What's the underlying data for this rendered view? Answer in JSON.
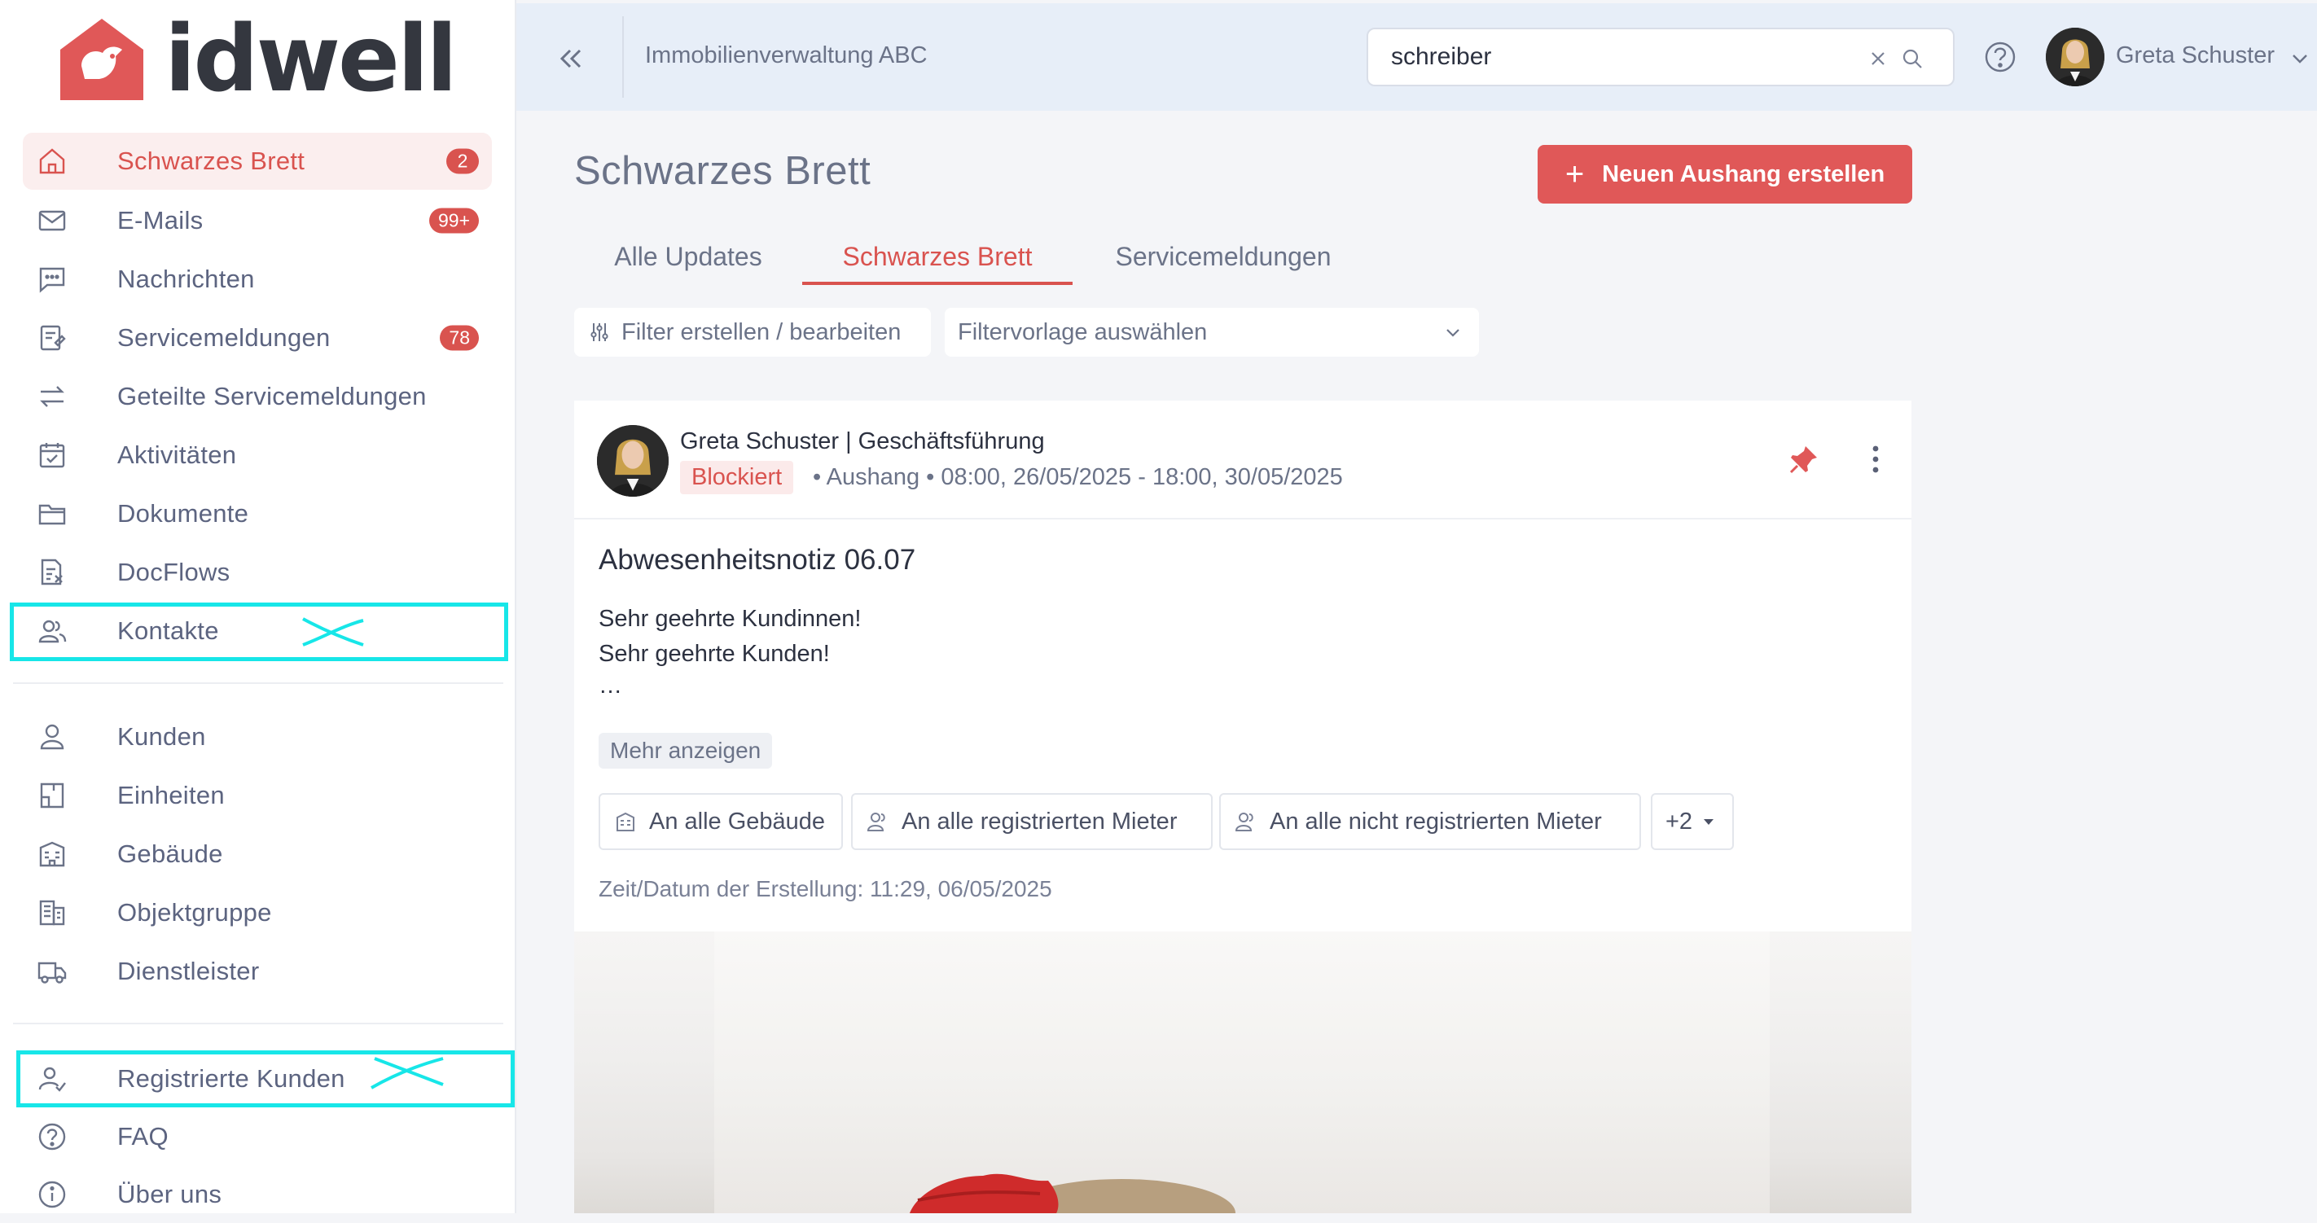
{
  "brand": {
    "name": "idwell",
    "color": "#e05858"
  },
  "sidebar": {
    "items": [
      {
        "label": "Schwarzes Brett",
        "icon": "home-icon",
        "badge": "2",
        "active": true
      },
      {
        "label": "E-Mails",
        "icon": "mail-icon",
        "badge": "99+"
      },
      {
        "label": "Nachrichten",
        "icon": "chat-icon"
      },
      {
        "label": "Servicemeldungen",
        "icon": "service-report-icon",
        "badge": "78"
      },
      {
        "label": "Geteilte Servicemeldungen",
        "icon": "arrows-exchange-icon"
      },
      {
        "label": "Aktivitäten",
        "icon": "calendar-check-icon"
      },
      {
        "label": "Dokumente",
        "icon": "folder-icon"
      },
      {
        "label": "DocFlows",
        "icon": "docflow-icon"
      },
      {
        "label": "Kontakte",
        "icon": "contacts-icon"
      },
      {
        "label": "Kunden",
        "icon": "user-icon"
      },
      {
        "label": "Einheiten",
        "icon": "unit-icon"
      },
      {
        "label": "Gebäude",
        "icon": "building-icon"
      },
      {
        "label": "Objektgruppe",
        "icon": "object-group-icon"
      },
      {
        "label": "Dienstleister",
        "icon": "truck-icon"
      },
      {
        "label": "Registrierte Kunden",
        "icon": "registered-user-icon"
      },
      {
        "label": "FAQ",
        "icon": "question-circle-icon"
      },
      {
        "label": "Über uns",
        "icon": "info-circle-icon"
      }
    ]
  },
  "header": {
    "organization": "Immobilienverwaltung ABC",
    "search": {
      "value": "schreiber"
    },
    "user": {
      "name": "Greta Schuster"
    }
  },
  "main": {
    "title": "Schwarzes Brett",
    "new_button": "Neuen Aushang erstellen",
    "tabs": [
      {
        "label": "Alle Updates"
      },
      {
        "label": "Schwarzes Brett",
        "active": true
      },
      {
        "label": "Servicemeldungen"
      }
    ],
    "filter_edit": "Filter erstellen / bearbeiten",
    "filter_template": "Filtervorlage auswählen"
  },
  "post": {
    "author": "Greta Schuster | Geschäftsführung",
    "status": "Blockiert",
    "type_line": "• Aushang • 08:00, 26/05/2025 - 18:00, 30/05/2025",
    "title": "Abwesenheitsnotiz 06.07",
    "body": [
      "Sehr geehrte Kundinnen!",
      "Sehr geehrte Kunden!",
      "…"
    ],
    "more_label": "Mehr anzeigen",
    "audiences": [
      "An alle Gebäude",
      "An alle registrierten Mieter",
      "An alle nicht registrierten Mieter"
    ],
    "audience_more": "+2",
    "created": "Zeit/Datum der Erstellung: 11:29, 06/05/2025"
  },
  "colors": {
    "accent": "#d9534f",
    "annotation": "#17e6e8",
    "header_bg": "#e7eef8"
  }
}
